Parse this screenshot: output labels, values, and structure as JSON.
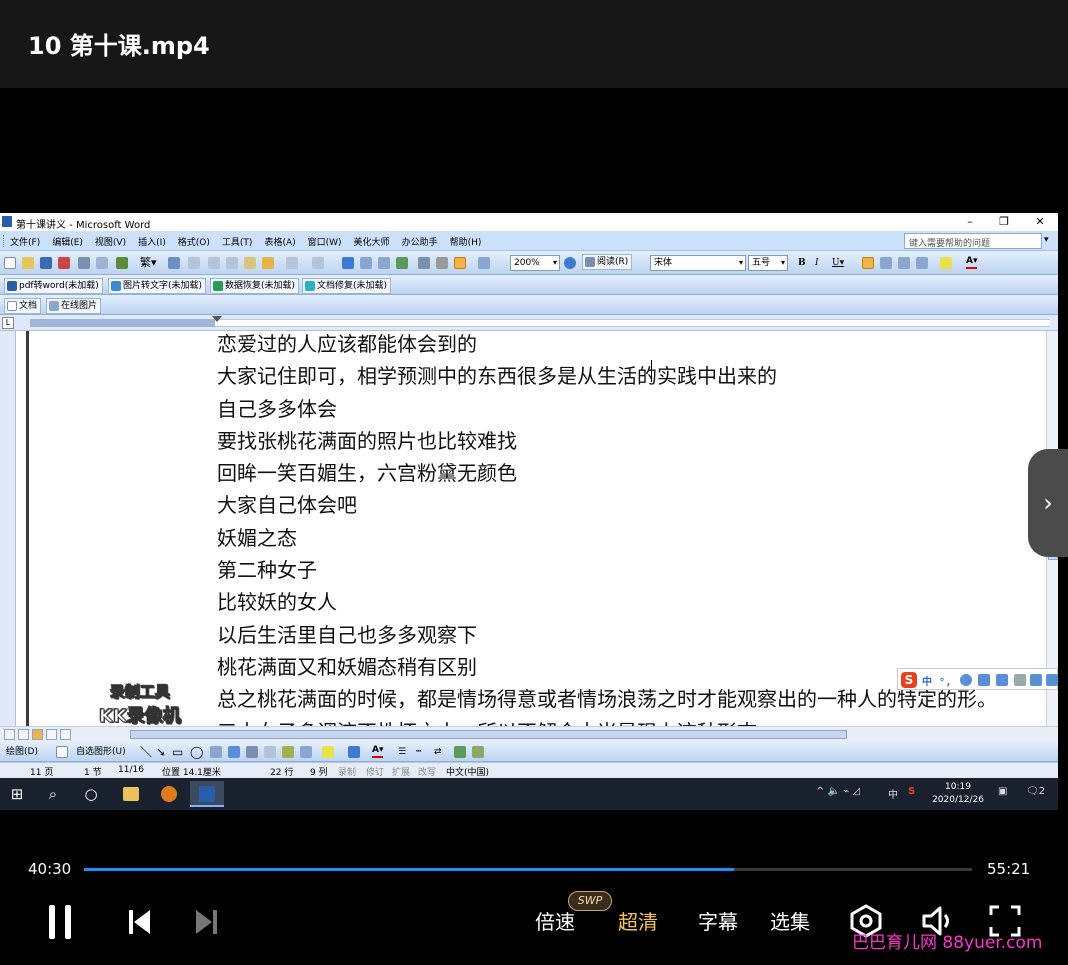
{
  "player": {
    "title": "10 第十课.mp4",
    "current_time": "40:30",
    "total_time": "55:21",
    "progress": 0.732,
    "accent_color": "#1e8fff",
    "buttons": {
      "speed": "倍速",
      "speed_badge": "SWP",
      "quality": "超清",
      "subtitle": "字幕",
      "episodes": "选集"
    },
    "site_watermark": "巴巴育儿网 88yuer.com"
  },
  "word": {
    "window_title": "第十课讲义 - Microsoft Word",
    "menu": [
      "文件(F)",
      "编辑(E)",
      "视图(V)",
      "插入(I)",
      "格式(O)",
      "工具(T)",
      "表格(A)",
      "窗口(W)",
      "美化大师",
      "办公助手",
      "帮助(H)"
    ],
    "help_placeholder": "键入需要帮助的问题",
    "toolbar": {
      "zoom": "200%",
      "read_mode": "阅读(R)",
      "font": "宋体",
      "size": "五号"
    },
    "addins": [
      "pdf转word(未加载)",
      "图片转文字(未加载)",
      "数据恢复(未加载)",
      "文档修复(未加载)"
    ],
    "toolbar3": [
      "文档",
      "在线图片"
    ],
    "document_lines": [
      "恋爱过的人应该都能体会到的",
      "大家记住即可，相学预测中的东西很多是从生活的实践中出来的",
      "自己多多体会",
      "要找张桃花满面的照片也比较难找",
      "回眸一笑百媚生，六宫粉黛无颜色",
      "大家自己体会吧",
      "妖媚之态",
      "第二种女子",
      "比较妖的女人",
      "以后生活里自己也多多观察下",
      "桃花满面又和妖媚态稍有区别",
      "总之桃花满面的时候，都是情场得意或者情场浪荡之时才能观察出的一种人的特定的形。",
      "三大女子多调流不性怀之人，所以不解合大米是现上这种形态"
    ],
    "recorder_watermark": [
      "录制工具",
      "KK录像机"
    ],
    "ime_status": "中 °,",
    "draw_toolbar": [
      "绘图(D)",
      "自选图形(U)"
    ],
    "status": {
      "page": "11 页",
      "section": "1 节",
      "pages": "11/16",
      "position": "位置 14.1厘米",
      "line": "22 行",
      "col": "9 列",
      "rec": "录制",
      "trk": "修订",
      "ext": "扩展",
      "ovr": "改写",
      "lang": "中文(中国)"
    }
  },
  "taskbar": {
    "tray_lang": "中",
    "clock_time": "10:19",
    "clock_date": "2020/12/26",
    "notification_count": "2"
  }
}
